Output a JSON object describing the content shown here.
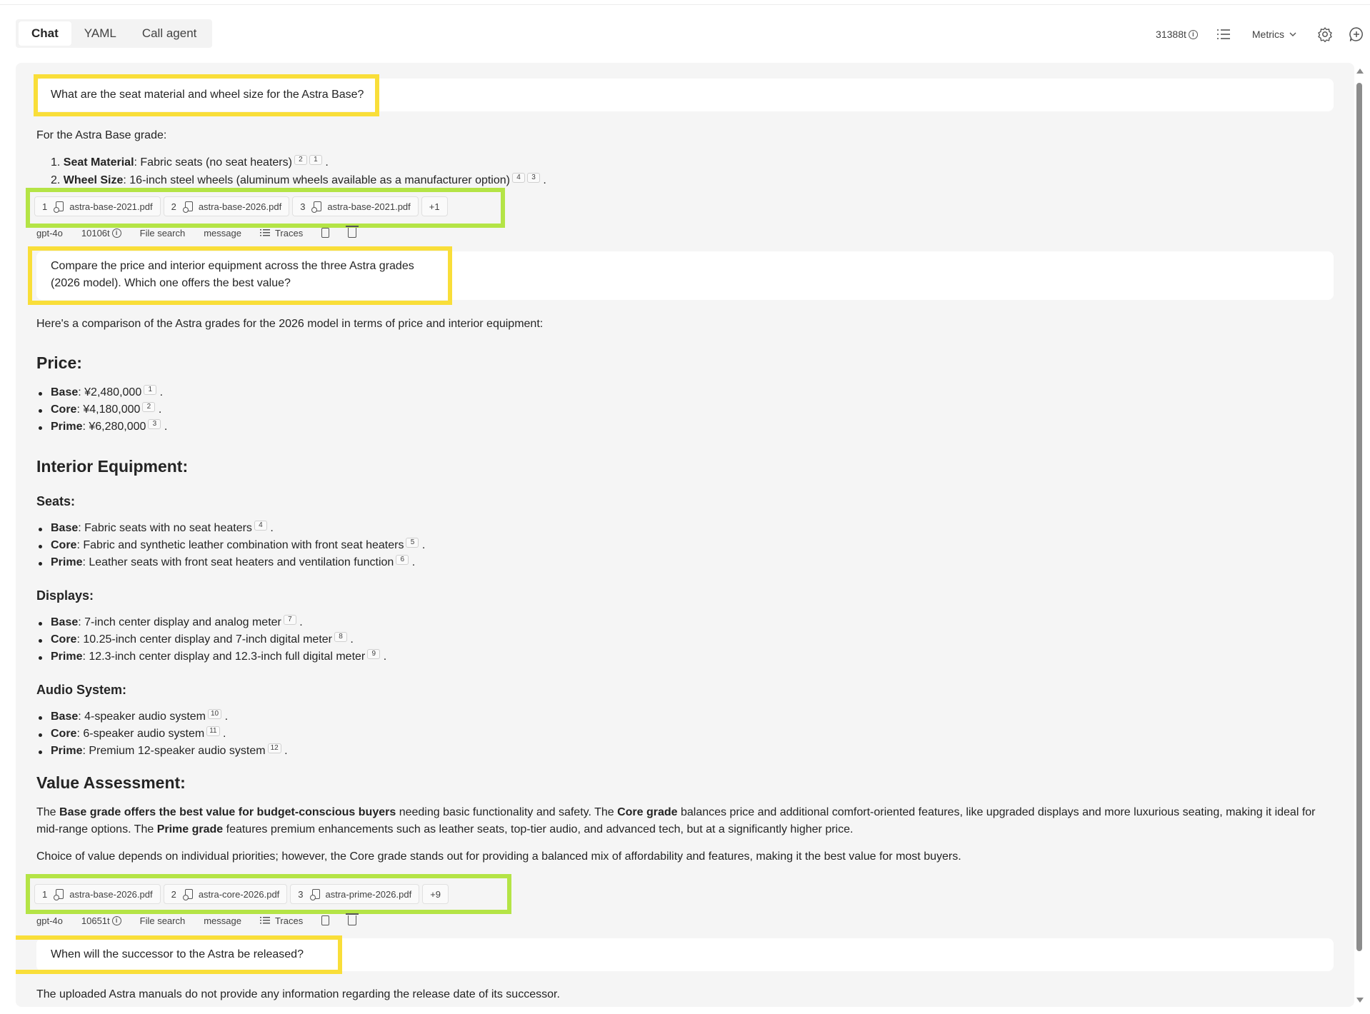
{
  "tabs": [
    "Chat",
    "YAML",
    "Call agent"
  ],
  "header": {
    "tokens": "31388t",
    "metrics_label": "Metrics"
  },
  "q1": "What are the seat material and wheel size for the Astra Base?",
  "a1": {
    "intro": "For the Astra Base grade:",
    "items": [
      {
        "num": "1.",
        "label": "Seat Material",
        "text": ": Fabric seats (no seat heaters)",
        "refs": [
          "2",
          "1"
        ]
      },
      {
        "num": "2.",
        "label": "Wheel Size",
        "text": ": 16-inch steel wheels (aluminum wheels available as a manufacturer option)",
        "refs": [
          "4",
          "3"
        ]
      }
    ],
    "citations": [
      {
        "num": "1",
        "file": "astra-base-2021.pdf"
      },
      {
        "num": "2",
        "file": "astra-base-2026.pdf"
      },
      {
        "num": "3",
        "file": "astra-base-2021.pdf"
      }
    ],
    "more": "+1",
    "meta": {
      "model": "gpt-4o",
      "tokens": "10106t",
      "tool": "File search",
      "type": "message",
      "traces": "Traces"
    }
  },
  "q2": {
    "line1": "Compare the price and interior equipment across the three Astra grades",
    "line2": "(2026 model). Which one offers the best value?"
  },
  "a2": {
    "intro": "Here's a comparison of the Astra grades for the 2026 model in terms of price and interior equipment:",
    "price_heading": "Price:",
    "price": [
      {
        "label": "Base",
        "text": ": ¥2,480,000",
        "ref": "1"
      },
      {
        "label": "Core",
        "text": ": ¥4,180,000",
        "ref": "2"
      },
      {
        "label": "Prime",
        "text": ": ¥6,280,000",
        "ref": "3"
      }
    ],
    "interior_heading": "Interior Equipment:",
    "seats_heading": "Seats:",
    "seats": [
      {
        "label": "Base",
        "text": ": Fabric seats with no seat heaters",
        "ref": "4"
      },
      {
        "label": "Core",
        "text": ": Fabric and synthetic leather combination with front seat heaters",
        "ref": "5"
      },
      {
        "label": "Prime",
        "text": ": Leather seats with front seat heaters and ventilation function",
        "ref": "6"
      }
    ],
    "displays_heading": "Displays:",
    "displays": [
      {
        "label": "Base",
        "text": ": 7-inch center display and analog meter",
        "ref": "7"
      },
      {
        "label": "Core",
        "text": ": 10.25-inch center display and 7-inch digital meter",
        "ref": "8"
      },
      {
        "label": "Prime",
        "text": ": 12.3-inch center display and 12.3-inch full digital meter",
        "ref": "9"
      }
    ],
    "audio_heading": "Audio System:",
    "audio": [
      {
        "label": "Base",
        "text": ": 4-speaker audio system",
        "ref": "10"
      },
      {
        "label": "Core",
        "text": ": 6-speaker audio system",
        "ref": "11"
      },
      {
        "label": "Prime",
        "text": ": Premium 12-speaker audio system",
        "ref": "12"
      }
    ],
    "value_heading": "Value Assessment:",
    "value_p1": {
      "t1": "The ",
      "b1": "Base grade offers the best value for budget-conscious buyers",
      "t2": " needing basic functionality and safety. The ",
      "b2": "Core grade",
      "t3": " balances price and additional comfort-oriented features, like upgraded displays and more luxurious seating, making it ideal for",
      "t4": "mid-range options. The ",
      "b3": "Prime grade",
      "t5": " features premium enhancements such as leather seats, top-tier audio, and advanced tech, but at a significantly higher price."
    },
    "value_p2": "Choice of value depends on individual priorities; however, the Core grade stands out for providing a balanced mix of affordability and features, making it the best value for most buyers.",
    "citations": [
      {
        "num": "1",
        "file": "astra-base-2026.pdf"
      },
      {
        "num": "2",
        "file": "astra-core-2026.pdf"
      },
      {
        "num": "3",
        "file": "astra-prime-2026.pdf"
      }
    ],
    "more": "+9",
    "meta": {
      "model": "gpt-4o",
      "tokens": "10651t",
      "tool": "File search",
      "type": "message",
      "traces": "Traces"
    }
  },
  "q3": "When will the successor to the Astra be released?",
  "a3": "The uploaded Astra manuals do not provide any information regarding the release date of its successor.",
  "colors": {
    "yellow_highlight": "#f9de39",
    "green_highlight": "#b4e446",
    "panel_bg": "#f5f5f5"
  },
  "icons": [
    "info-icon",
    "list-icon",
    "chevron-down-icon",
    "gear-icon",
    "add-chat-icon",
    "file-icon",
    "traces-icon",
    "copy-icon",
    "trash-icon"
  ]
}
